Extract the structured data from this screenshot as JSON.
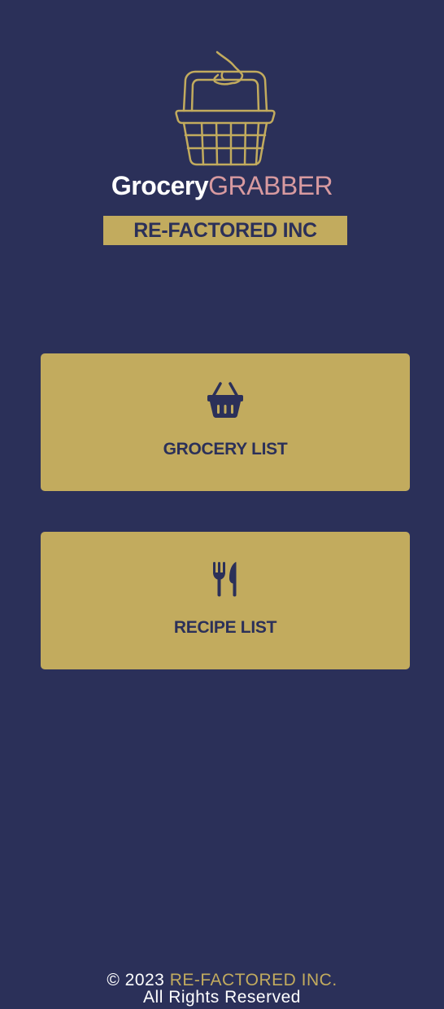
{
  "colors": {
    "background": "#2b3059",
    "accent_gold": "#c2ab5e",
    "brand_pink": "#d89aa0",
    "text_light": "#ffffff",
    "text_dark": "#2b3059"
  },
  "brand": {
    "logo_icon": "basket-with-hand-icon",
    "name_part1": "Grocery",
    "name_part2": "GRABBER",
    "company_banner": "RE-FACTORED INC"
  },
  "nav": [
    {
      "label": "GROCERY LIST",
      "icon": "shopping-basket-icon"
    },
    {
      "label": "RECIPE LIST",
      "icon": "fork-knife-icon"
    }
  ],
  "footer": {
    "copyright": "© 2023",
    "company": "RE-FACTORED INC.",
    "rights": "All Rights Reserved"
  }
}
